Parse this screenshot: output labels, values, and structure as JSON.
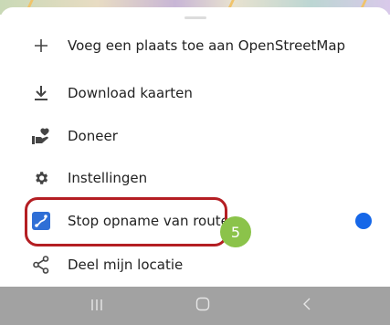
{
  "menu": {
    "items": [
      {
        "label": "Voeg een plaats toe aan OpenStreetMap",
        "icon": "plus-icon"
      },
      {
        "label": "Download kaarten",
        "icon": "download-icon"
      },
      {
        "label": "Doneer",
        "icon": "donate-hand-heart-icon"
      },
      {
        "label": "Instellingen",
        "icon": "gear-icon"
      },
      {
        "label": "Stop opname van route",
        "icon": "route-recording-icon"
      },
      {
        "label": "Deel mijn locatie",
        "icon": "share-icon"
      }
    ]
  },
  "annotation": {
    "step_number": "5",
    "color": "#b41e23",
    "badge_color": "#8bc34a"
  },
  "status": {
    "recording_dot_color": "#1667e8"
  },
  "navbar": {
    "buttons": [
      "recent-apps-icon",
      "home-icon",
      "back-icon"
    ]
  }
}
